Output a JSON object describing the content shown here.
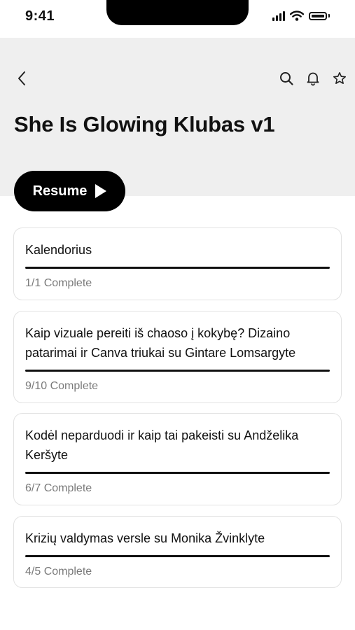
{
  "status_bar": {
    "time": "9:41"
  },
  "header": {
    "title": "She Is Glowing Klubas v1"
  },
  "resume_button": {
    "label": "Resume"
  },
  "courses": [
    {
      "title": "Kalendorius",
      "status": "1/1 Complete",
      "progress": 1.0
    },
    {
      "title": "Kaip vizuale pereiti iš chaoso į kokybę? Dizaino patarimai ir Canva triukai su Gintare Lomsargyte",
      "status": "9/10 Complete",
      "progress": 1.0
    },
    {
      "title": "Kodėl neparduodi ir kaip tai pakeisti su Andželika Keršyte",
      "status": "6/7 Complete",
      "progress": 1.0
    },
    {
      "title": "Krizių valdymas versle su Monika Žvinklyte",
      "status": "4/5 Complete",
      "progress": 1.0
    }
  ],
  "icons": {
    "back": "chevron-left-icon",
    "search": "search-icon",
    "notifications": "bell-icon",
    "favorite": "star-icon",
    "play": "play-icon"
  },
  "colors": {
    "header_bg": "#efefef",
    "accent": "#000000",
    "muted_text": "#7a7a7a"
  }
}
